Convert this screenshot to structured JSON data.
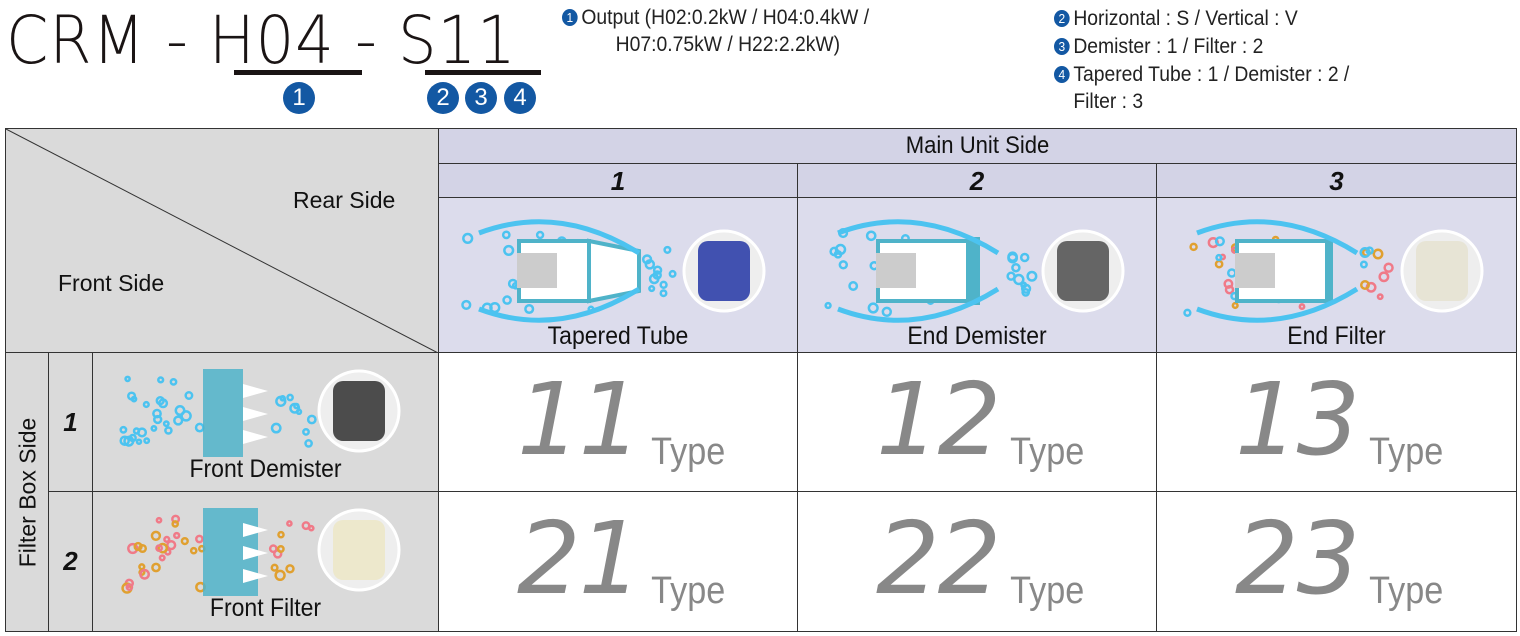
{
  "header": {
    "model_prefix": "CRM",
    "sep": "-",
    "output_code": "H04",
    "spec_code": "S11",
    "badges": [
      "1",
      "2",
      "3",
      "4"
    ],
    "notes": {
      "output": "Output (H02:0.2kW / H04:0.4kW /\n          H07:0.75kW / H22:2.2kW)",
      "orientation": "Horizontal : S / Vertical : V",
      "filter_box": "Demister : 1 / Filter : 2",
      "main_unit": "Tapered Tube : 1 / Demister : 2 /\nFilter : 3"
    }
  },
  "table": {
    "rear_side": "Rear Side",
    "front_side": "Front Side",
    "main_unit_side": "Main Unit Side",
    "filter_box_side": "Filter Box Side",
    "columns": [
      {
        "num": "1",
        "caption": "Tapered Tube"
      },
      {
        "num": "2",
        "caption": "End Demister"
      },
      {
        "num": "3",
        "caption": "End Filter"
      }
    ],
    "rows": [
      {
        "num": "1",
        "caption": "Front Demister",
        "types": [
          "11",
          "12",
          "13"
        ]
      },
      {
        "num": "2",
        "caption": "Front Filter",
        "types": [
          "21",
          "22",
          "23"
        ]
      }
    ],
    "type_label": "Type"
  },
  "colors": {
    "badge": "#1358a3",
    "air": "#4cc3f0",
    "filter": "#4fb3c9",
    "type_text": "#888888"
  }
}
